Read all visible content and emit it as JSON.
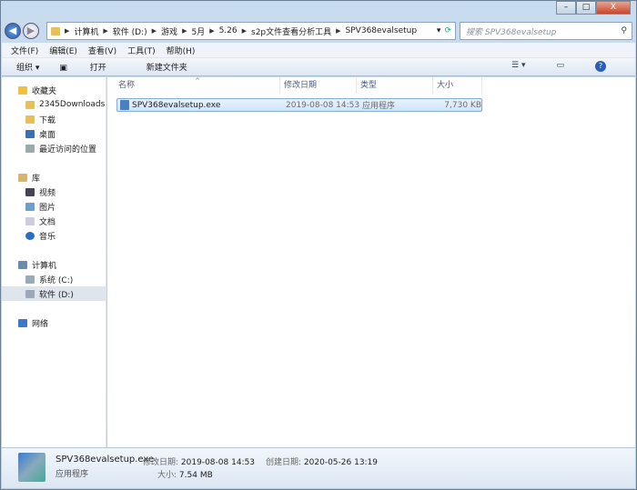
{
  "window": {
    "minimize": "–",
    "maximize": "□",
    "close": "X"
  },
  "address": {
    "crumbs": [
      "计算机",
      "软件 (D:)",
      "游戏",
      "5月",
      "5.26",
      "s2p文件查看分析工具",
      "SPV368evalsetup"
    ],
    "search_placeholder": "搜索 SPV368evalsetup"
  },
  "menu": [
    "文件(F)",
    "编辑(E)",
    "查看(V)",
    "工具(T)",
    "帮助(H)"
  ],
  "toolbar": {
    "organize": "组织 ▾",
    "open": "打开",
    "new_folder": "新建文件夹"
  },
  "sidebar": {
    "favorites": {
      "label": "收藏夹",
      "items": [
        "2345Downloads",
        "下载",
        "桌面",
        "最近访问的位置"
      ]
    },
    "libraries": {
      "label": "库",
      "items": [
        "视频",
        "图片",
        "文档",
        "音乐"
      ]
    },
    "computer": {
      "label": "计算机",
      "items": [
        "系统 (C:)",
        "软件 (D:)"
      ]
    },
    "network": {
      "label": "网络"
    }
  },
  "columns": [
    "名称",
    "修改日期",
    "类型",
    "大小"
  ],
  "files": [
    {
      "name": "SPV368evalsetup.exe",
      "modified": "2019-08-08 14:53",
      "type": "应用程序",
      "size": "7,730 KB"
    }
  ],
  "status": {
    "name": "SPV368evalsetup.exe",
    "type": "应用程序",
    "modified_label": "修改日期:",
    "modified": "2019-08-08 14:53",
    "created_label": "创建日期:",
    "created": "2020-05-26 13:19",
    "size_label": "大小:",
    "size": "7.54 MB"
  }
}
